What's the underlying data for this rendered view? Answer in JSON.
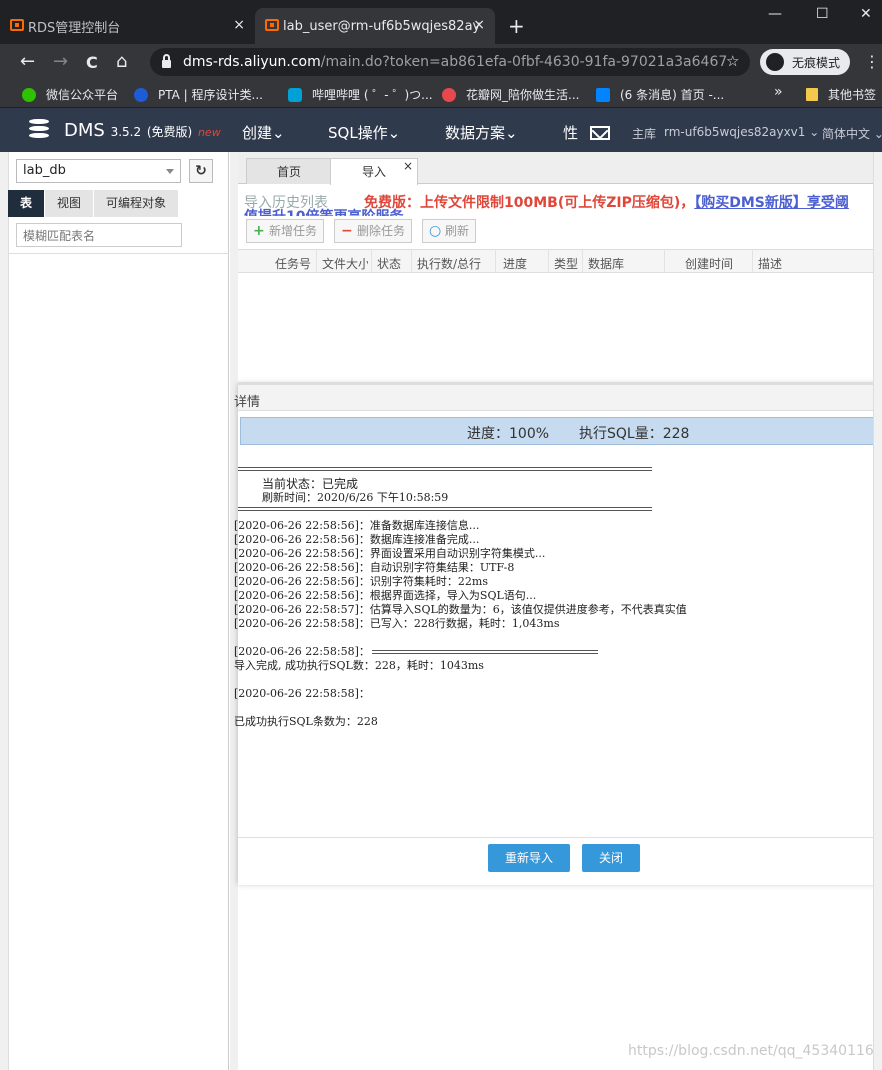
{
  "browser": {
    "tabs": [
      {
        "title": "RDS管理控制台"
      },
      {
        "title": "lab_user@rm-uf6b5wqjes82ay"
      }
    ],
    "tab_close": "×",
    "new_tab": "+",
    "window_controls": {
      "minimize": "—",
      "maximize": "☐",
      "close": "✕"
    },
    "nav": {
      "back": "←",
      "forward": "→",
      "reload": "C",
      "home": "⌂"
    },
    "url_host": "dms-rds.aliyun.com",
    "url_path": "/main.do?token=ab861efa-0fbf-4630-91fa-97021a3a6467",
    "star": "☆",
    "incognito_label": "无痕模式",
    "menu": "⋮",
    "bookmarks": [
      {
        "label": "微信公众平台",
        "color": "#2dc100"
      },
      {
        "label": "PTA | 程序设计类...",
        "color": "#1e5bd6"
      },
      {
        "label": "哔哩哔哩 ( ゜- ゜)つ...",
        "color": "#00a1d6"
      },
      {
        "label": "花瓣网_陪你做生活...",
        "color": "#e5484d"
      },
      {
        "label": "(6 条消息) 首页 -...",
        "color": "#0084ff"
      }
    ],
    "bookmarks_more": "»",
    "other_bookmarks": "其他书签"
  },
  "dms": {
    "title": "DMS",
    "version": "3.5.2",
    "edition": "(免费版)",
    "new_badge": "new",
    "menu": [
      "创建⌄",
      "SQL操作⌄",
      "数据方案⌄",
      "性"
    ],
    "main_db_label": "主库",
    "instance": "rm-uf6b5wqjes82ayxv1 ⌄",
    "language": "简体中文 ⌄"
  },
  "sidebar": {
    "database": "lab_db",
    "refresh": "↻",
    "tabs": [
      "表",
      "视图",
      "可编程对象"
    ],
    "filter_placeholder": "模糊匹配表名"
  },
  "main": {
    "tabs": [
      "首页",
      "导入"
    ],
    "tab_close": "×",
    "history_title": "导入历史列表",
    "free_notice": "免费版：上传文件限制100MB(可上传ZIP压缩包)，",
    "buy_link": "【购买DMS新版】享受阈",
    "sub_notice": "值提升10倍等更高阶服务",
    "actions": [
      {
        "label": "新增任务",
        "icon": "+",
        "color": "#4caf50"
      },
      {
        "label": "删除任务",
        "icon": "−",
        "color": "#e0473a"
      },
      {
        "label": "刷新",
        "icon": "○",
        "color": "#3498db"
      }
    ],
    "columns": [
      "任务号",
      "文件大小",
      "状态",
      "执行数/总行",
      "进度",
      "类型",
      "数据库",
      "创建时间",
      "描述"
    ]
  },
  "dialog": {
    "title": "详情",
    "progress_label": "进度：100%",
    "sql_count_label": "执行SQL量：228",
    "status_line": "当前状态：已完成",
    "refresh_line": "刷新时间：2020/6/26 下午10:58:59",
    "log_lines": [
      "[2020-06-26 22:58:56]：准备数据库连接信息...",
      "[2020-06-26 22:58:56]：数据库连接准备完成...",
      "[2020-06-26 22:58:56]：界面设置采用自动识别字符集模式...",
      "[2020-06-26 22:58:56]：自动识别字符集结果：UTF-8",
      "[2020-06-26 22:58:56]：识别字符集耗时：22ms",
      "[2020-06-26 22:58:56]：根据界面选择，导入为SQL语句...",
      "[2020-06-26 22:58:57]：估算导入SQL的数量为：6，该值仅提供进度参考，不代表真实值",
      "[2020-06-26 22:58:58]：已写入：228行数据，耗时：1,043ms"
    ],
    "summary_time": "[2020-06-26 22:58:58]：",
    "summary_line": "导入完成, 成功执行SQL数：228，耗时：1043ms",
    "final_time": "[2020-06-26 22:58:58]：",
    "final_line": "已成功执行SQL条数为：228",
    "buttons": {
      "reimport": "重新导入",
      "close": "关闭"
    }
  },
  "watermark": "https://blog.csdn.net/qq_45340116"
}
